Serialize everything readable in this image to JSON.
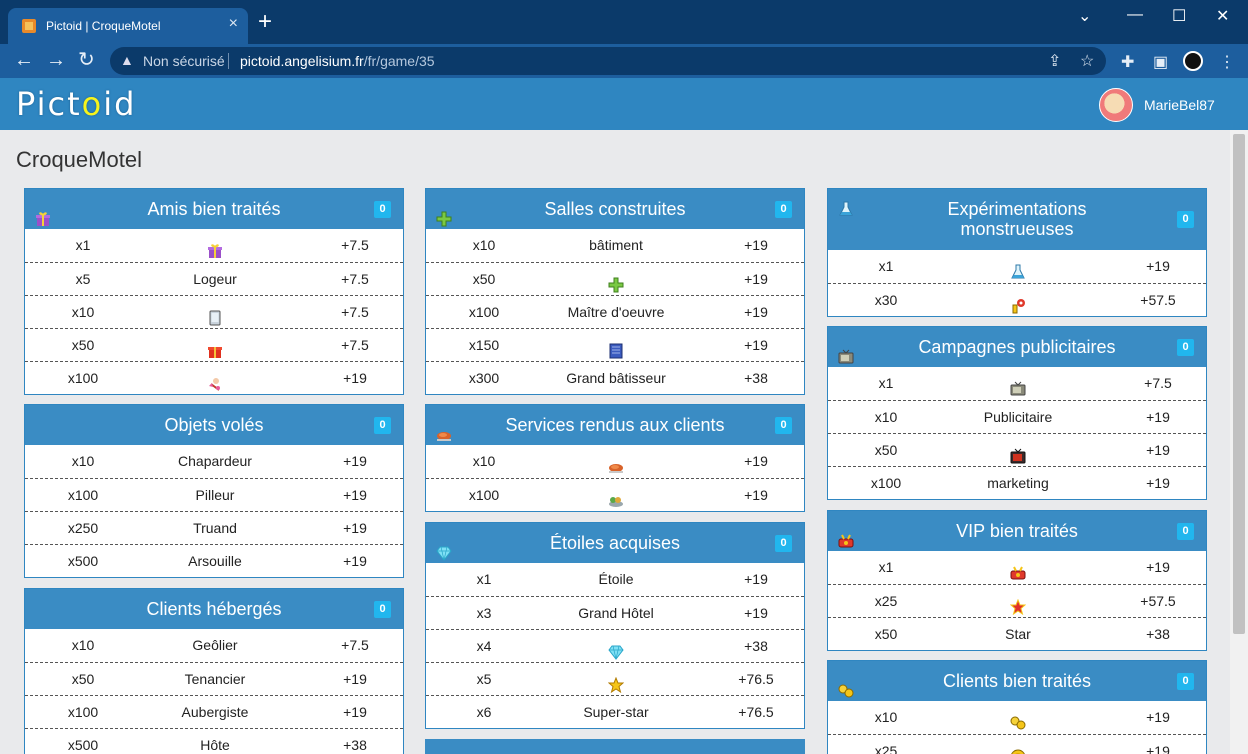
{
  "browser": {
    "tab_title": "Pictoid | CroqueMotel",
    "insecure_label": "Non sécurisé",
    "url_host": "pictoid.angelisium.fr",
    "url_path": "/fr/game/35"
  },
  "site": {
    "logo_prefix": "Pict",
    "logo_o": "o",
    "logo_suffix": "id",
    "username": "MarieBel87",
    "page_title": "CroqueMotel"
  },
  "cards": [
    {
      "title": "Amis bien traités",
      "badge": "0",
      "rows": [
        {
          "count": "x1",
          "label": "",
          "icon": "gift-purple-icon",
          "points": "+7.5"
        },
        {
          "count": "x5",
          "label": "Logeur",
          "icon": "",
          "points": "+7.5"
        },
        {
          "count": "x10",
          "label": "",
          "icon": "tablet-icon",
          "points": "+7.5"
        },
        {
          "count": "x50",
          "label": "",
          "icon": "gift-red-icon",
          "points": "+7.5"
        },
        {
          "count": "x100",
          "label": "",
          "icon": "cupid-icon",
          "points": "+19"
        }
      ]
    },
    {
      "title": "Objets volés",
      "badge": "0",
      "rows": [
        {
          "count": "x10",
          "label": "Chapardeur",
          "icon": "",
          "points": "+19"
        },
        {
          "count": "x100",
          "label": "Pilleur",
          "icon": "",
          "points": "+19"
        },
        {
          "count": "x250",
          "label": "Truand",
          "icon": "",
          "points": "+19"
        },
        {
          "count": "x500",
          "label": "Arsouille",
          "icon": "",
          "points": "+19"
        }
      ]
    },
    {
      "title": "Clients hébergés",
      "badge": "0",
      "rows": [
        {
          "count": "x10",
          "label": "Geôlier",
          "icon": "",
          "points": "+7.5"
        },
        {
          "count": "x50",
          "label": "Tenancier",
          "icon": "",
          "points": "+19"
        },
        {
          "count": "x100",
          "label": "Aubergiste",
          "icon": "",
          "points": "+19"
        },
        {
          "count": "x500",
          "label": "Hôte",
          "icon": "",
          "points": "+38"
        }
      ]
    },
    {
      "title": "Salles construites",
      "badge": "0",
      "rows": [
        {
          "count": "x10",
          "label": "bâtiment",
          "icon": "",
          "points": "+19"
        },
        {
          "count": "x50",
          "label": "",
          "icon": "green-cross-icon",
          "points": "+19"
        },
        {
          "count": "x100",
          "label": "Maître d'oeuvre",
          "icon": "",
          "points": "+19"
        },
        {
          "count": "x150",
          "label": "",
          "icon": "blueprint-icon",
          "points": "+19"
        },
        {
          "count": "x300",
          "label": "Grand bâtisseur",
          "icon": "",
          "points": "+38"
        }
      ]
    },
    {
      "title": "Services rendus aux clients",
      "badge": "0",
      "rows": [
        {
          "count": "x10",
          "label": "",
          "icon": "roast-chicken-icon",
          "points": "+19"
        },
        {
          "count": "x100",
          "label": "",
          "icon": "food-tray-icon",
          "points": "+19"
        }
      ]
    },
    {
      "title": "Étoiles acquises",
      "badge": "0",
      "rows": [
        {
          "count": "x1",
          "label": "Étoile",
          "icon": "",
          "points": "+19"
        },
        {
          "count": "x3",
          "label": "Grand Hôtel",
          "icon": "",
          "points": "+19"
        },
        {
          "count": "x4",
          "label": "",
          "icon": "diamond-icon",
          "points": "+38"
        },
        {
          "count": "x5",
          "label": "",
          "icon": "gold-star-icon",
          "points": "+76.5"
        },
        {
          "count": "x6",
          "label": "Super-star",
          "icon": "",
          "points": "+76.5"
        }
      ]
    },
    {
      "title": "Expérimentations monstrueuses",
      "badge": "0",
      "rows": [
        {
          "count": "x1",
          "label": "",
          "icon": "flask-icon",
          "points": "+19"
        },
        {
          "count": "x30",
          "label": "",
          "icon": "lab-skull-icon",
          "points": "+57.5"
        }
      ]
    },
    {
      "title": "Campagnes publicitaires",
      "badge": "0",
      "rows": [
        {
          "count": "x1",
          "label": "",
          "icon": "tv-icon",
          "points": "+7.5"
        },
        {
          "count": "x10",
          "label": "Publicitaire",
          "icon": "",
          "points": "+19"
        },
        {
          "count": "x50",
          "label": "",
          "icon": "tv-red-icon",
          "points": "+19"
        },
        {
          "count": "x100",
          "label": "marketing",
          "icon": "",
          "points": "+19"
        }
      ]
    },
    {
      "title": "VIP bien traités",
      "badge": "0",
      "rows": [
        {
          "count": "x1",
          "label": "",
          "icon": "vip-icon",
          "points": "+19"
        },
        {
          "count": "x25",
          "label": "",
          "icon": "red-star-icon",
          "points": "+57.5"
        },
        {
          "count": "x50",
          "label": "Star",
          "icon": "",
          "points": "+38"
        }
      ]
    },
    {
      "title": "Clients bien traités",
      "badge": "0",
      "rows": [
        {
          "count": "x10",
          "label": "",
          "icon": "happy-client-icon",
          "points": "+19"
        },
        {
          "count": "x25",
          "label": "",
          "icon": "gold-coin-icon",
          "points": "+19"
        }
      ]
    }
  ]
}
